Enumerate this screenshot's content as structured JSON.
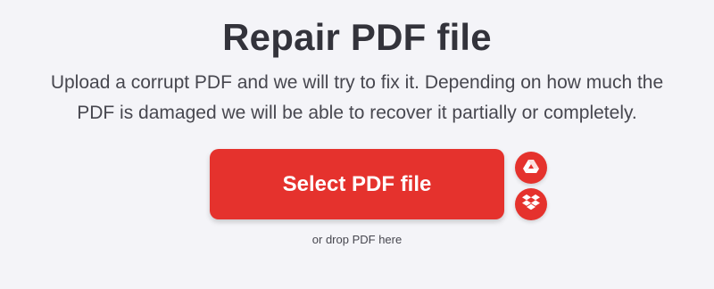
{
  "page": {
    "title": "Repair PDF file",
    "description_line1": "Upload a corrupt PDF and we will try to fix it. Depending on how much the",
    "description_line2": "PDF is damaged we will be able to recover it partially or completely."
  },
  "upload": {
    "select_button_label": "Select PDF file",
    "drop_hint": "or drop PDF here",
    "cloud_sources": [
      {
        "icon": "google-drive-icon"
      },
      {
        "icon": "dropbox-icon"
      }
    ]
  },
  "colors": {
    "accent": "#e5322d",
    "background": "#f4f4f8",
    "text": "#33333b"
  }
}
